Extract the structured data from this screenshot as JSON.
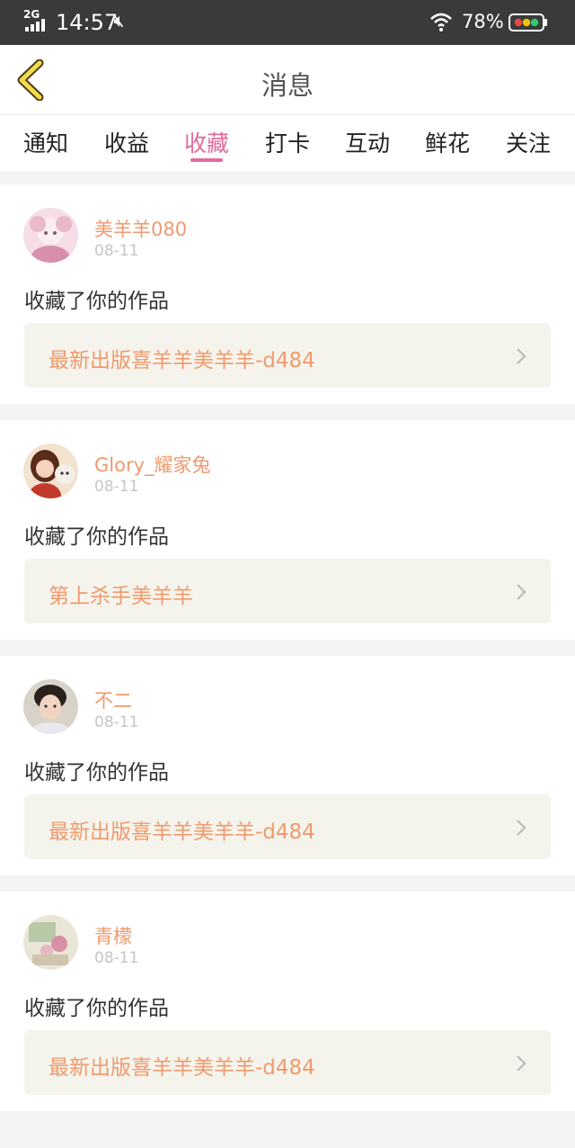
{
  "status_bar": {
    "network": "2G",
    "time": "14:57",
    "battery": "78%"
  },
  "header": {
    "title": "消息"
  },
  "tabs": [
    {
      "label": "通知"
    },
    {
      "label": "收益"
    },
    {
      "label": "收藏",
      "active": true
    },
    {
      "label": "打卡"
    },
    {
      "label": "互动"
    },
    {
      "label": "鲜花"
    },
    {
      "label": "关注"
    }
  ],
  "colors": {
    "accent_pink": "#e06b9b",
    "username_orange": "#ef9a6e",
    "link_bg": "#f5f4ec"
  },
  "notifications": [
    {
      "user": "美羊羊080",
      "date": "08-11",
      "action": "收藏了你的作品",
      "work": "最新出版喜羊羊美羊羊-d484"
    },
    {
      "user": "Glory_耀家兔",
      "date": "08-11",
      "action": "收藏了你的作品",
      "work": "第上杀手美羊羊"
    },
    {
      "user": "不二",
      "date": "08-11",
      "action": "收藏了你的作品",
      "work": "最新出版喜羊羊美羊羊-d484"
    },
    {
      "user": "青檬",
      "date": "08-11",
      "action": "收藏了你的作品",
      "work": "最新出版喜羊羊美羊羊-d484"
    }
  ]
}
